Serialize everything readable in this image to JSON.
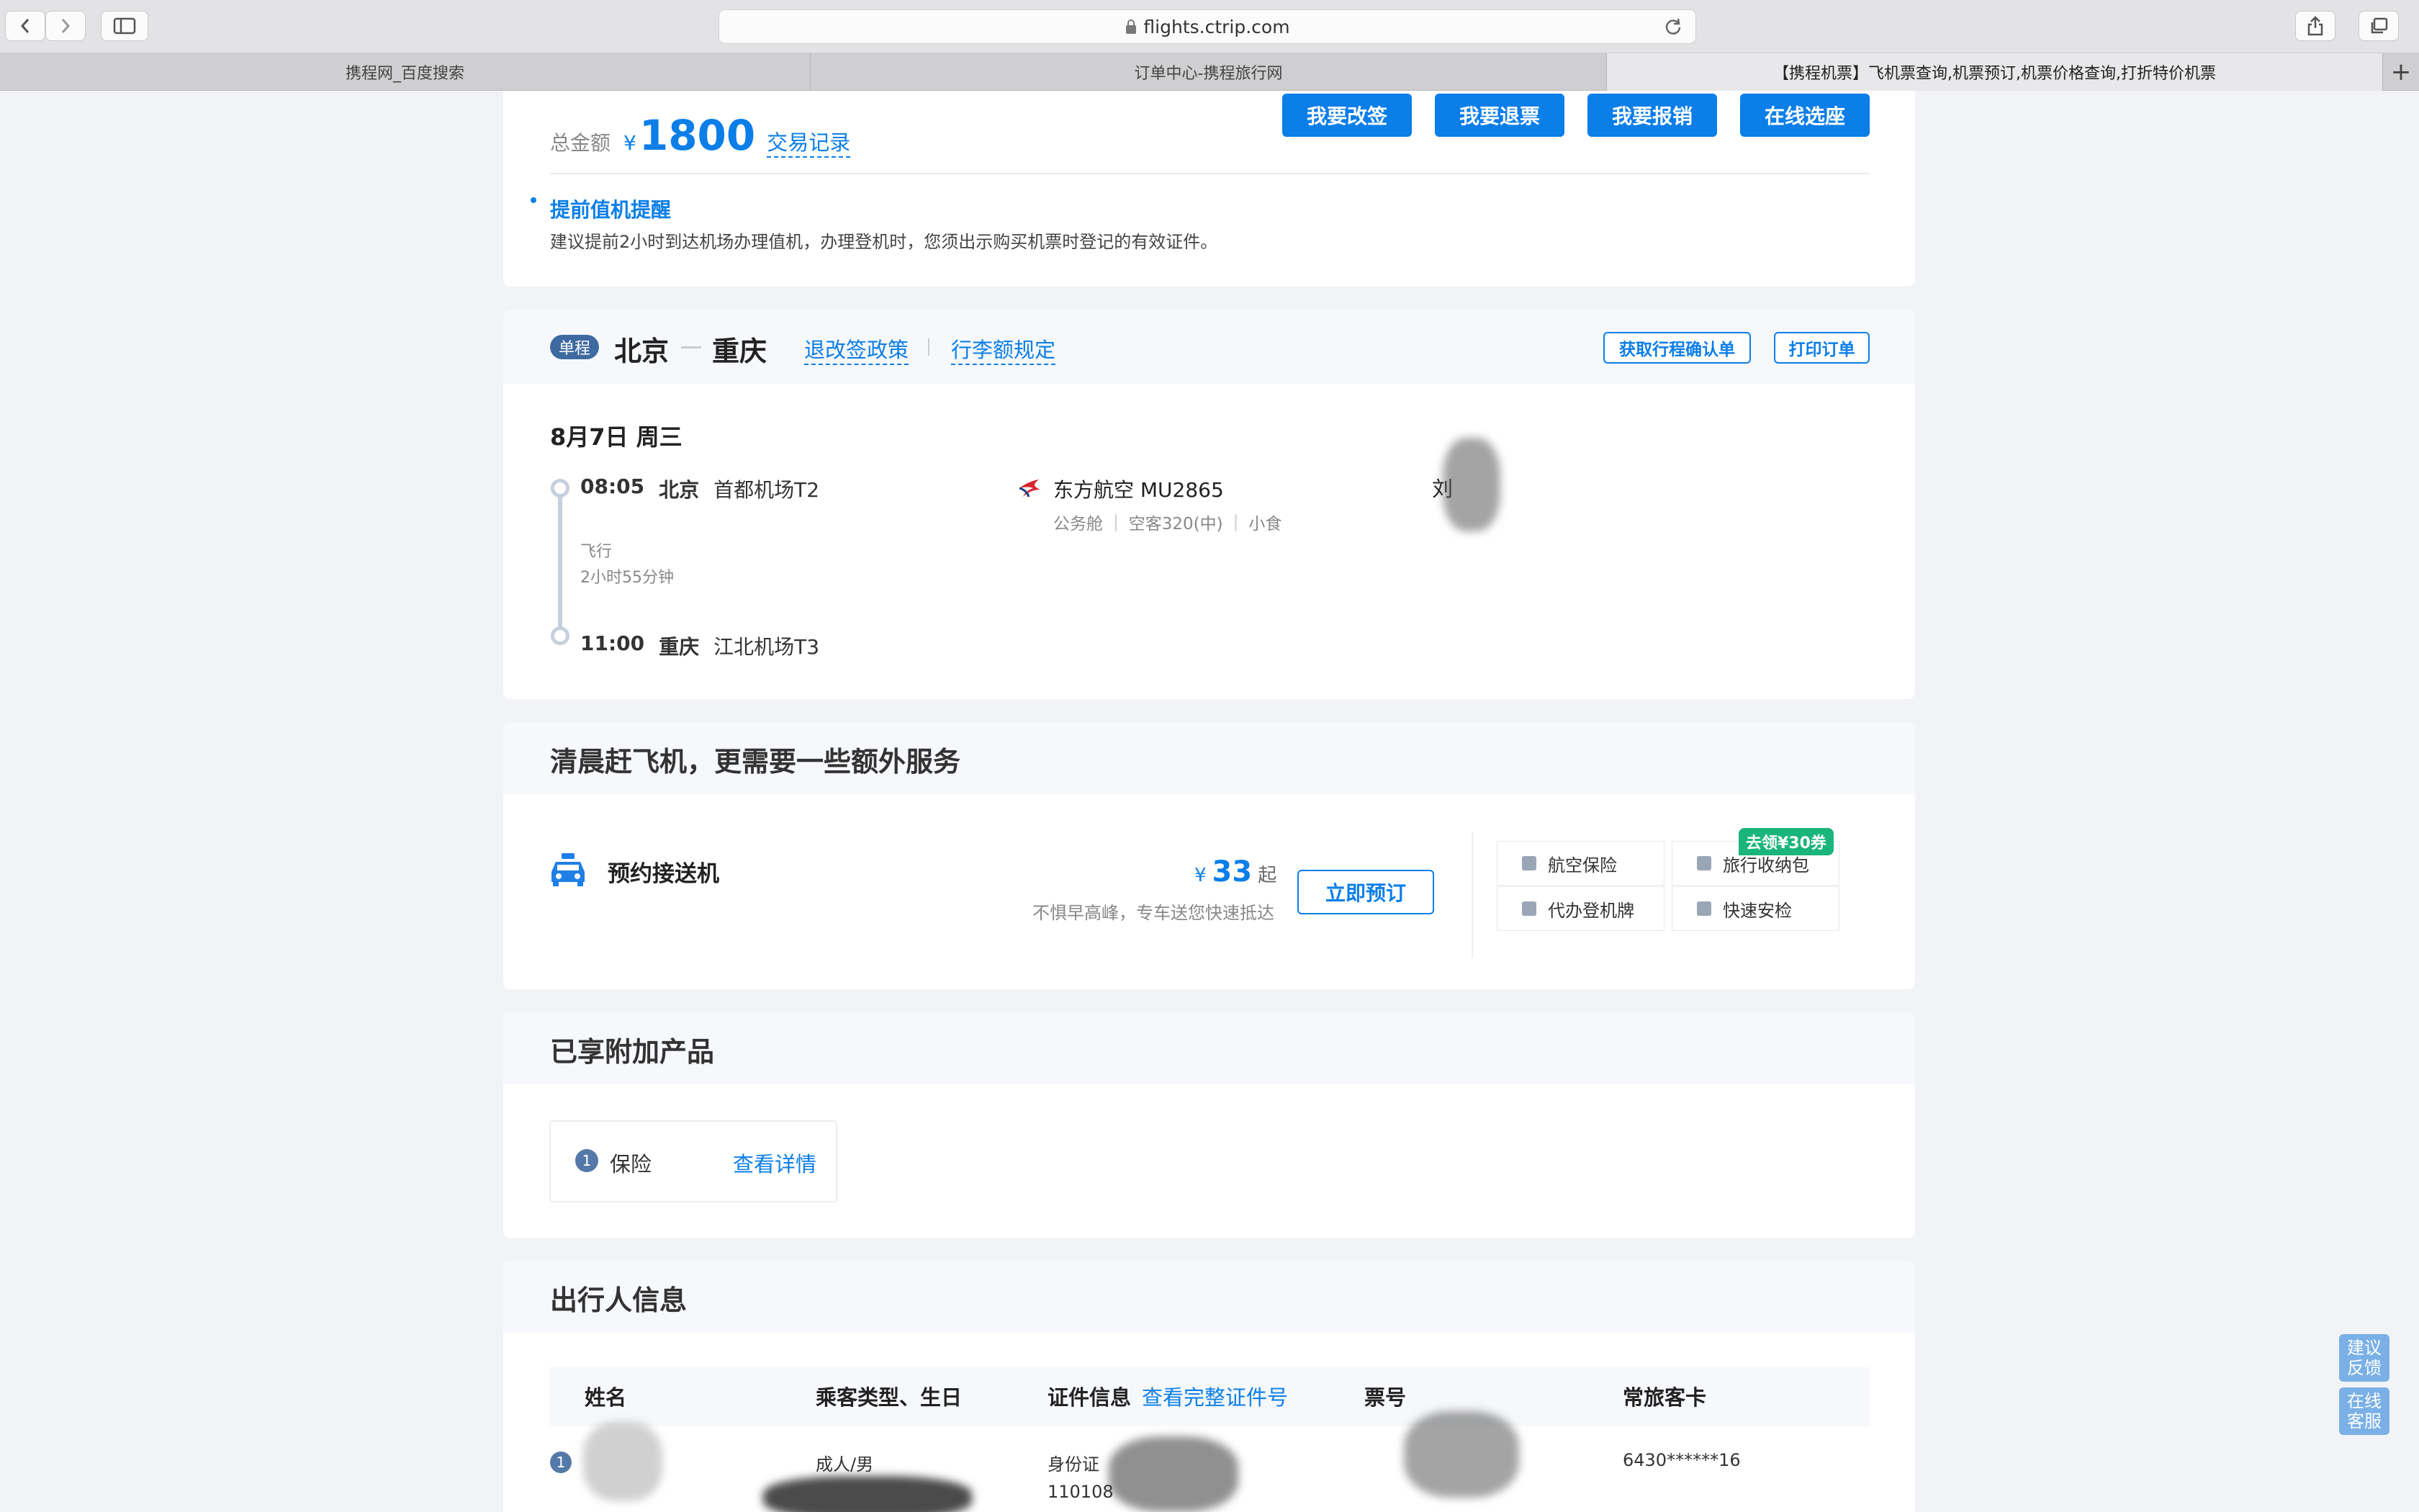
{
  "browser": {
    "url": "flights.ctrip.com",
    "tabs": [
      {
        "label": "携程网_百度搜索"
      },
      {
        "label": "订单中心-携程旅行网"
      },
      {
        "label": "【携程机票】飞机票查询,机票预订,机票价格查询,打折特价机票"
      }
    ]
  },
  "summary": {
    "total_label": "总金额",
    "currency": "¥",
    "amount": "1800",
    "transactions_link": "交易记录",
    "buttons": {
      "change": "我要改签",
      "refund": "我要退票",
      "reimburse": "我要报销",
      "seat": "在线选座"
    },
    "notice_title": "提前值机提醒",
    "notice_text": "建议提前2小时到达机场办理值机，办理登机时，您须出示购买机票时登记的有效证件。"
  },
  "trip": {
    "badge": "单程",
    "from": "北京",
    "to": "重庆",
    "policy_link": "退改签政策",
    "baggage_link": "行李额规定",
    "confirm_button": "获取行程确认单",
    "print_button": "打印订单",
    "date": "8月7日 周三",
    "dep_time": "08:05",
    "dep_city": "北京",
    "dep_airport": "首都机场T2",
    "fly_label": "飞行",
    "duration": "2小时55分钟",
    "arr_time": "11:00",
    "arr_city": "重庆",
    "arr_airport": "江北机场T3",
    "airline": "东方航空 MU2865",
    "cabin": "公务舱",
    "aircraft": "空客320(中)",
    "meal": "小食",
    "passenger_initial": "刘"
  },
  "extras": {
    "title": "清晨赶飞机，更需要一些额外服务",
    "transfer_label": "预约接送机",
    "currency": "¥",
    "price": "33",
    "price_suffix": "起",
    "desc": "不惧早高峰，专车送您快速抵达",
    "book_button": "立即预订",
    "coupon_badge": "去领¥30券",
    "services": {
      "insurance": "航空保险",
      "storage": "旅行收纳包",
      "boarding": "代办登机牌",
      "security": "快速安检"
    }
  },
  "addons": {
    "title": "已享附加产品",
    "count": "1",
    "item": "保险",
    "detail_link": "查看详情"
  },
  "travelers": {
    "title": "出行人信息",
    "headers": {
      "name": "姓名",
      "type": "乘客类型、生日",
      "id": "证件信息",
      "id_link": "查看完整证件号",
      "ticket": "票号",
      "ffp": "常旅客卡"
    },
    "row": {
      "index": "1",
      "type": "成人/男",
      "id_type": "身份证",
      "id_number": "110108",
      "ffp": "6430******16"
    }
  },
  "side": {
    "feedback": "建议\n反馈",
    "service": "在线\n客服"
  },
  "colors": {
    "accent": "#0b7ee8",
    "coupon": "#19b57b"
  }
}
